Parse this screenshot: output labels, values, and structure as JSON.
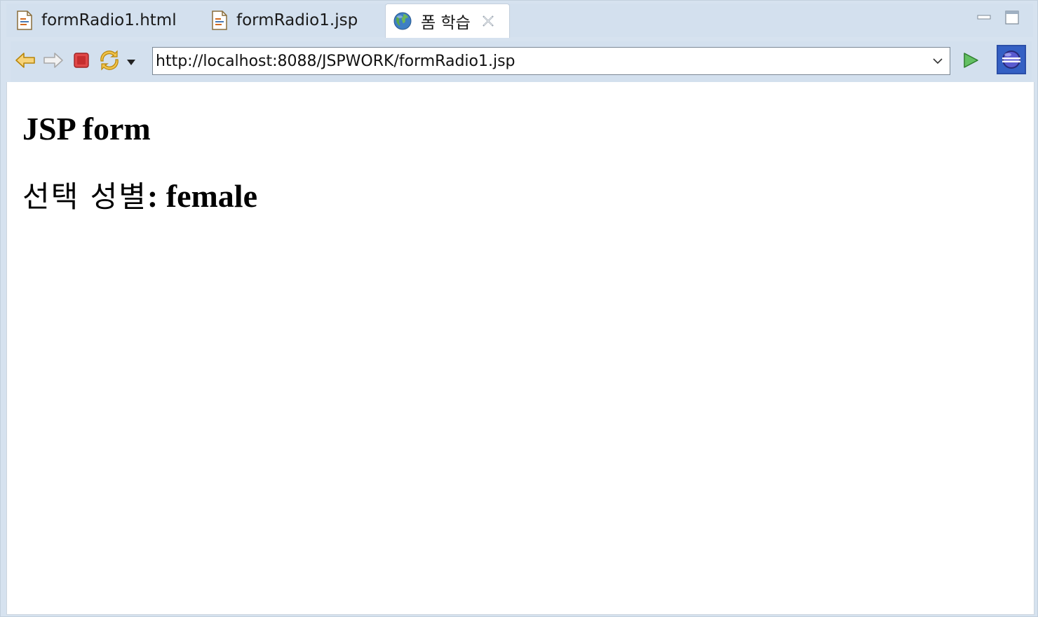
{
  "tabs": [
    {
      "label": "formRadio1.html",
      "icon": "html-file-icon",
      "active": false
    },
    {
      "label": "formRadio1.jsp",
      "icon": "jsp-file-icon",
      "active": false
    },
    {
      "label": "폼 학습",
      "icon": "globe-icon",
      "active": true
    }
  ],
  "toolbar": {
    "back_icon": "back-arrow-icon",
    "forward_icon": "forward-arrow-icon",
    "stop_icon": "stop-icon",
    "refresh_icon": "refresh-icon",
    "url": "http://localhost:8088/JSPWORK/formRadio1.jsp",
    "go_icon": "go-icon",
    "browser_icon": "eclipse-browser-icon"
  },
  "page": {
    "heading": "JSP form",
    "gender_label": "선택 성별",
    "gender_separator": ": ",
    "gender_value": "female"
  },
  "colors": {
    "chrome": "#d3e0ee",
    "back_arrow": "#e8a61c",
    "stop": "#d33b3b",
    "go": "#3a9a3a"
  }
}
